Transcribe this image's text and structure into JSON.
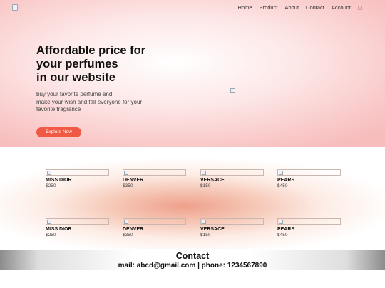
{
  "nav": {
    "items": [
      {
        "label": "Home"
      },
      {
        "label": "Product"
      },
      {
        "label": "About"
      },
      {
        "label": "Contact"
      },
      {
        "label": "Account"
      }
    ]
  },
  "hero": {
    "headline": "Affordable price for\nyour perfumes\nin our website",
    "subtext": "buy your favorite perfume and\nmake your wish and fall everyone for your\nfavorite fragrance",
    "cta_label": "Explore Now"
  },
  "products": [
    {
      "name": "MISS DIOR",
      "price": "$250"
    },
    {
      "name": "DENVER",
      "price": "$350"
    },
    {
      "name": "VERSACE",
      "price": "$150"
    },
    {
      "name": "PEARS",
      "price": "$450"
    },
    {
      "name": "MISS DIOR",
      "price": "$250"
    },
    {
      "name": "DENVER",
      "price": "$350"
    },
    {
      "name": "VERSACE",
      "price": "$150"
    },
    {
      "name": "PEARS",
      "price": "$450"
    }
  ],
  "contact": {
    "title": "Contact",
    "info": "mail: abcd@gmail.com | phone: 1234567890"
  },
  "colors": {
    "accent": "#f05a45",
    "hero_pink": "#f9c6c6"
  }
}
